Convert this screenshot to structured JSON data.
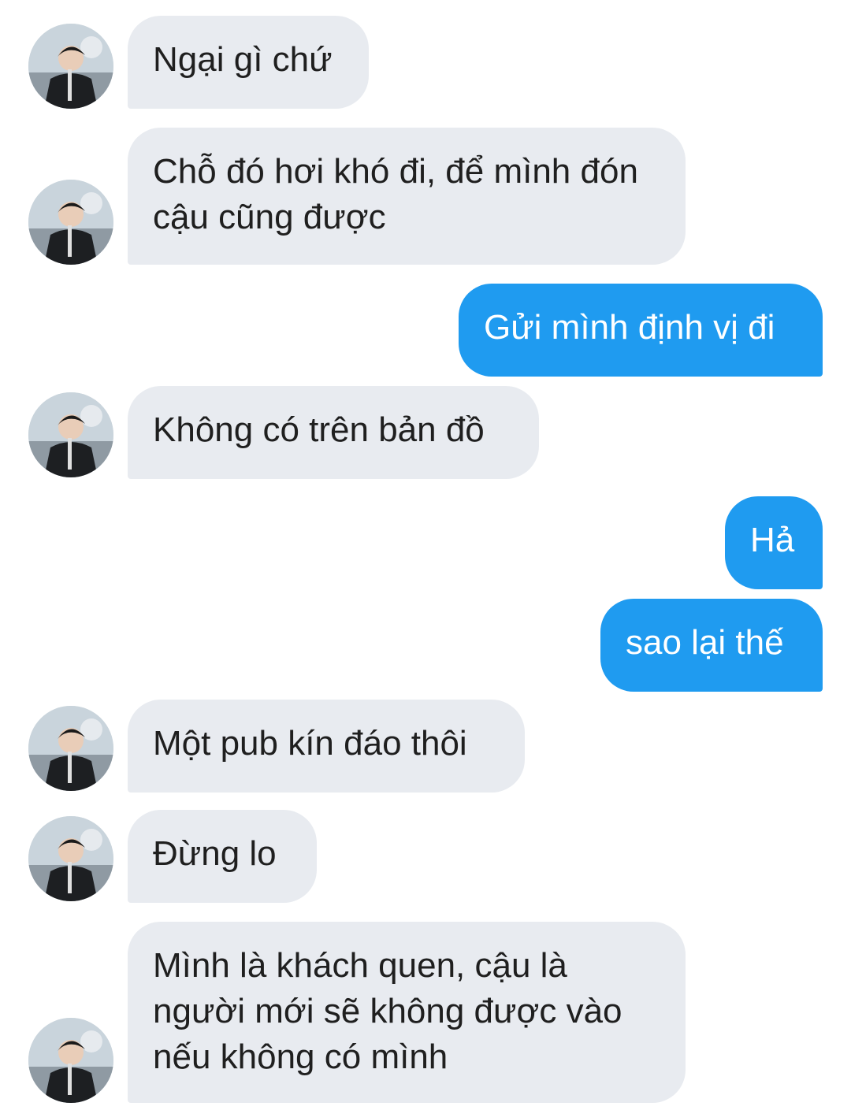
{
  "contact": {
    "avatar_icon": "avatar-photo-icon"
  },
  "colors": {
    "incoming_bubble": "#e8ebf0",
    "outgoing_bubble": "#1f9bf0",
    "incoming_text": "#1f1f1f",
    "outgoing_text": "#ffffff"
  },
  "messages": [
    {
      "sender": "contact",
      "text": "Ngại gì chứ"
    },
    {
      "sender": "contact",
      "text": "Chỗ đó hơi khó đi, để mình đón cậu cũng được"
    },
    {
      "sender": "me",
      "text": "Gửi mình định vị đi"
    },
    {
      "sender": "contact",
      "text": "Không có trên bản đồ"
    },
    {
      "sender": "me",
      "text": "Hả"
    },
    {
      "sender": "me",
      "text": "sao lại thế"
    },
    {
      "sender": "contact",
      "text": "Một pub kín đáo thôi"
    },
    {
      "sender": "contact",
      "text": "Đừng lo"
    },
    {
      "sender": "contact",
      "text": "Mình là khách quen, cậu là người mới sẽ không được vào nếu không có mình"
    }
  ]
}
